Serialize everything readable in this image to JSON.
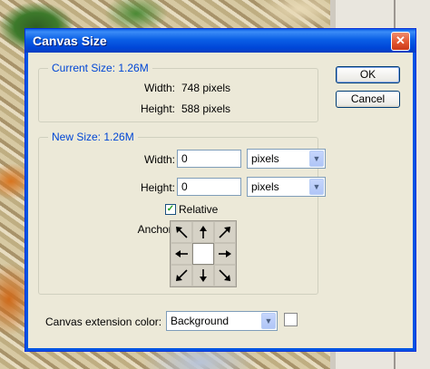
{
  "dialog": {
    "title": "Canvas Size",
    "close_icon": "close-icon"
  },
  "current_size": {
    "legend": "Current Size: 1.26M",
    "width_label": "Width:",
    "width_value": "748 pixels",
    "height_label": "Height:",
    "height_value": "588 pixels"
  },
  "new_size": {
    "legend": "New Size: 1.26M",
    "width_label": "Width:",
    "width_value": "0",
    "width_unit": "pixels",
    "height_label": "Height:",
    "height_value": "0",
    "height_unit": "pixels",
    "relative_label": "Relative",
    "relative_checked": true,
    "anchor_label": "Anchor:",
    "anchor_cells": [
      "arrow-nw-icon",
      "arrow-n-icon",
      "arrow-ne-icon",
      "arrow-w-icon",
      "anchor-center",
      "arrow-e-icon",
      "arrow-sw-icon",
      "arrow-s-icon",
      "arrow-se-icon"
    ]
  },
  "buttons": {
    "ok": "OK",
    "cancel": "Cancel"
  },
  "extension": {
    "label": "Canvas extension color:",
    "value": "Background",
    "swatch_color": "#ffffff"
  },
  "colors": {
    "title_bar": "#0a5fe6",
    "dialog_bg": "#ece9d8",
    "legend_text": "#0046d5"
  }
}
